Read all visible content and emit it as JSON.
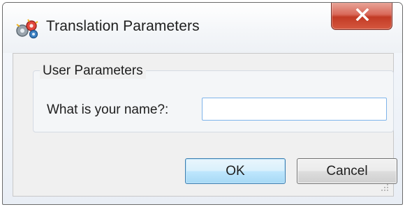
{
  "window": {
    "title": "Translation Parameters",
    "app_icon": "translation-gears-icon",
    "close_icon": "close-x-icon"
  },
  "group": {
    "legend": "User Parameters"
  },
  "form": {
    "name_label": "What is your name?:",
    "name_value": "",
    "name_placeholder": ""
  },
  "buttons": {
    "ok_label": "OK",
    "cancel_label": "Cancel"
  },
  "colors": {
    "close_button": "#c9432c",
    "default_button": "#bee6fd",
    "input_focus_border": "#7eb4ea"
  }
}
